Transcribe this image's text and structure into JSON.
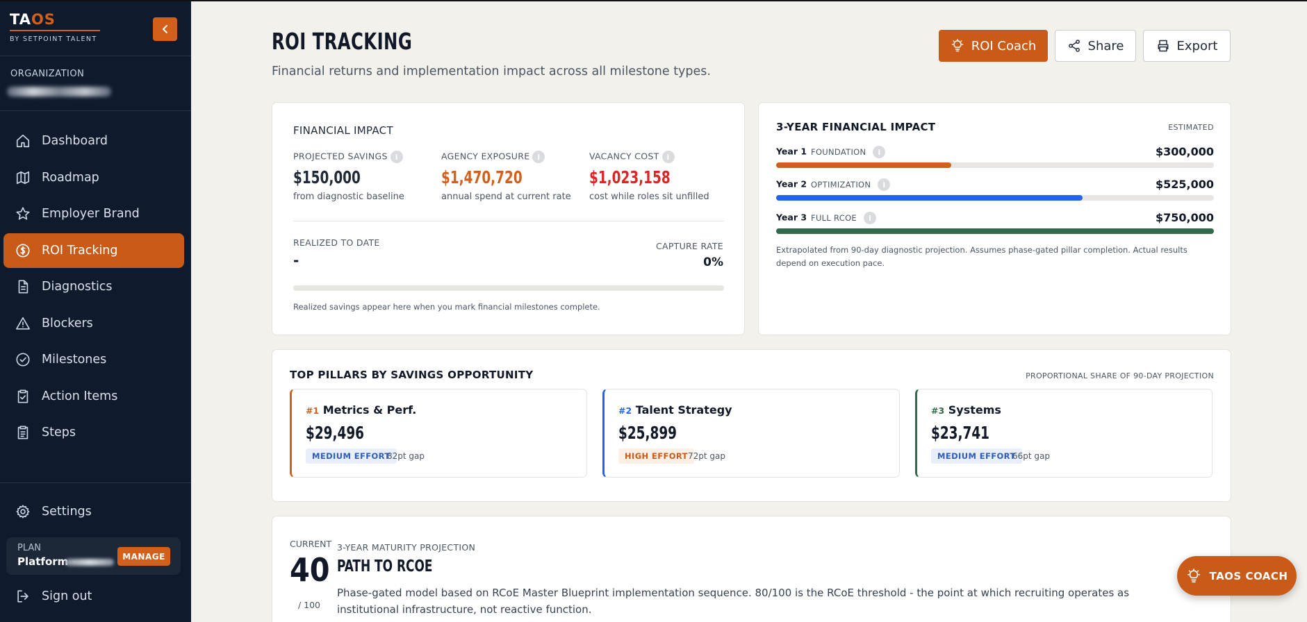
{
  "brand": {
    "logo_ta": "TA",
    "logo_os": "OS",
    "tagline": "BY SETPOINT TALENT",
    "accent": "#c95a17",
    "sidebar_bg": "#0f1b2d"
  },
  "sidebar": {
    "org_label": "ORGANIZATION",
    "items": [
      {
        "label": "Dashboard",
        "icon": "home-icon"
      },
      {
        "label": "Roadmap",
        "icon": "map-icon"
      },
      {
        "label": "Employer Brand",
        "icon": "star-icon"
      },
      {
        "label": "ROI Tracking",
        "icon": "dollar-icon",
        "active": true
      },
      {
        "label": "Diagnostics",
        "icon": "document-icon"
      },
      {
        "label": "Blockers",
        "icon": "warning-icon"
      },
      {
        "label": "Milestones",
        "icon": "check-circle-icon"
      },
      {
        "label": "Action Items",
        "icon": "clipboard-check-icon"
      },
      {
        "label": "Steps",
        "icon": "clipboard-list-icon"
      }
    ],
    "settings": "Settings",
    "plan_label": "PLAN",
    "plan_name": "Platform -",
    "manage": "MANAGE",
    "signout": "Sign out"
  },
  "header": {
    "title": "ROI TRACKING",
    "subtitle": "Financial returns and implementation impact across all milestone types.",
    "coach_btn": "ROI Coach",
    "share_btn": "Share",
    "export_btn": "Export"
  },
  "financial_impact": {
    "title": "FINANCIAL IMPACT",
    "info": "i",
    "stats": [
      {
        "label": "PROJECTED SAVINGS",
        "value": "$150,000",
        "note": "from diagnostic baseline",
        "color": "#111827"
      },
      {
        "label": "AGENCY EXPOSURE",
        "value": "$1,470,720",
        "note": "annual spend at current rate",
        "color": "#d2601a"
      },
      {
        "label": "VACANCY COST",
        "value": "$1,023,158",
        "note": "cost while roles sit unfilled",
        "color": "#dc2626"
      }
    ],
    "realized_label": "REALIZED TO DATE",
    "realized_value": "-",
    "capture_label": "CAPTURE RATE",
    "capture_value": "0%",
    "capture_fraction": 0,
    "footnote": "Realized savings appear here when you mark financial milestones complete."
  },
  "three_year": {
    "title": "3-YEAR FINANCIAL IMPACT",
    "tag": "ESTIMATED",
    "years": [
      {
        "year": "Year 1",
        "phase": "FOUNDATION",
        "value": "$300,000",
        "fraction": 0.4,
        "color": "#d2601a"
      },
      {
        "year": "Year 2",
        "phase": "OPTIMIZATION",
        "value": "$525,000",
        "fraction": 0.7,
        "color": "#2563eb"
      },
      {
        "year": "Year 3",
        "phase": "FULL RCOE",
        "value": "$750,000",
        "fraction": 1.0,
        "color": "#2f6b4a"
      }
    ],
    "footnote": "Extrapolated from 90-day diagnostic projection. Assumes phase-gated pillar completion. Actual results depend on execution pace."
  },
  "pillars": {
    "title": "TOP PILLARS BY SAVINGS OPPORTUNITY",
    "tag": "PROPORTIONAL SHARE OF 90-DAY PROJECTION",
    "items": [
      {
        "rank": "#1",
        "name": "Metrics & Perf.",
        "value": "$29,496",
        "effort": "MEDIUM EFFORT",
        "gap": "82pt gap",
        "accent": "#d2601a",
        "badge_bg": "#e8effb",
        "badge_fg": "#2f5db8"
      },
      {
        "rank": "#2",
        "name": "Talent Strategy",
        "value": "$25,899",
        "effort": "HIGH EFFORT",
        "gap": "72pt gap",
        "accent": "#2563eb",
        "badge_bg": "#fcefe6",
        "badge_fg": "#c95a17"
      },
      {
        "rank": "#3",
        "name": "Systems",
        "value": "$23,741",
        "effort": "MEDIUM EFFORT",
        "gap": "66pt gap",
        "accent": "#2f6b4a",
        "badge_bg": "#e8effb",
        "badge_fg": "#2f5db8"
      }
    ]
  },
  "maturity": {
    "current_label": "CURRENT",
    "current_value": "40",
    "out_of": "/ 100",
    "tag": "3-YEAR MATURITY PROJECTION",
    "title": "PATH TO RCOE",
    "description": "Phase-gated model based on RCoE Master Blueprint implementation sequence. 80/100 is the RCoE threshold - the point at which recruiting operates as institutional infrastructure, not reactive function."
  },
  "fab": {
    "label": "TAOS COACH"
  }
}
